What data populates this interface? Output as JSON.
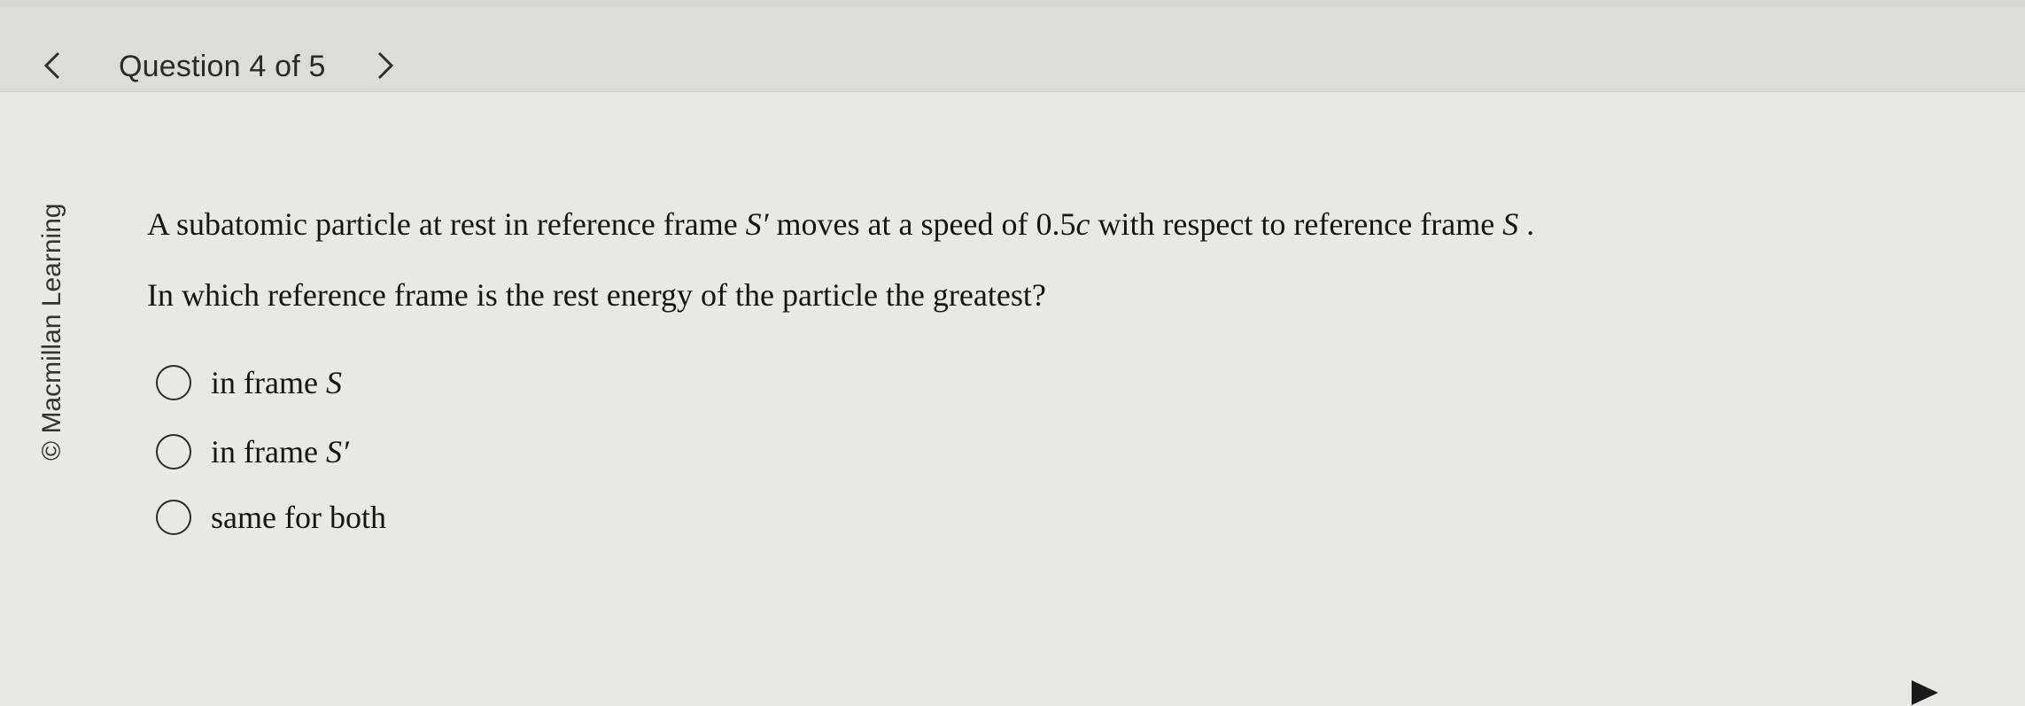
{
  "header": {
    "counter": "Question 4 of 5"
  },
  "side_credit": "© Macmillan Learning",
  "question": {
    "line1_prefix": "A subatomic particle at rest in reference frame ",
    "line1_frame1": "S′",
    "line1_middle": " moves at a speed of 0.5",
    "line1_c": "c",
    "line1_suffix": " with respect to reference frame ",
    "line1_frame2": "S",
    "line1_end": " .",
    "line2": "In which reference frame is the rest energy of the particle the greatest?"
  },
  "options": [
    {
      "text": "in frame ",
      "math": "S"
    },
    {
      "text": "in frame ",
      "math": "S′"
    },
    {
      "text": "same for both",
      "math": ""
    }
  ],
  "icons": {
    "prev": "chevron-left-icon",
    "next": "chevron-right-icon",
    "cursor": "mouse-cursor-icon"
  }
}
